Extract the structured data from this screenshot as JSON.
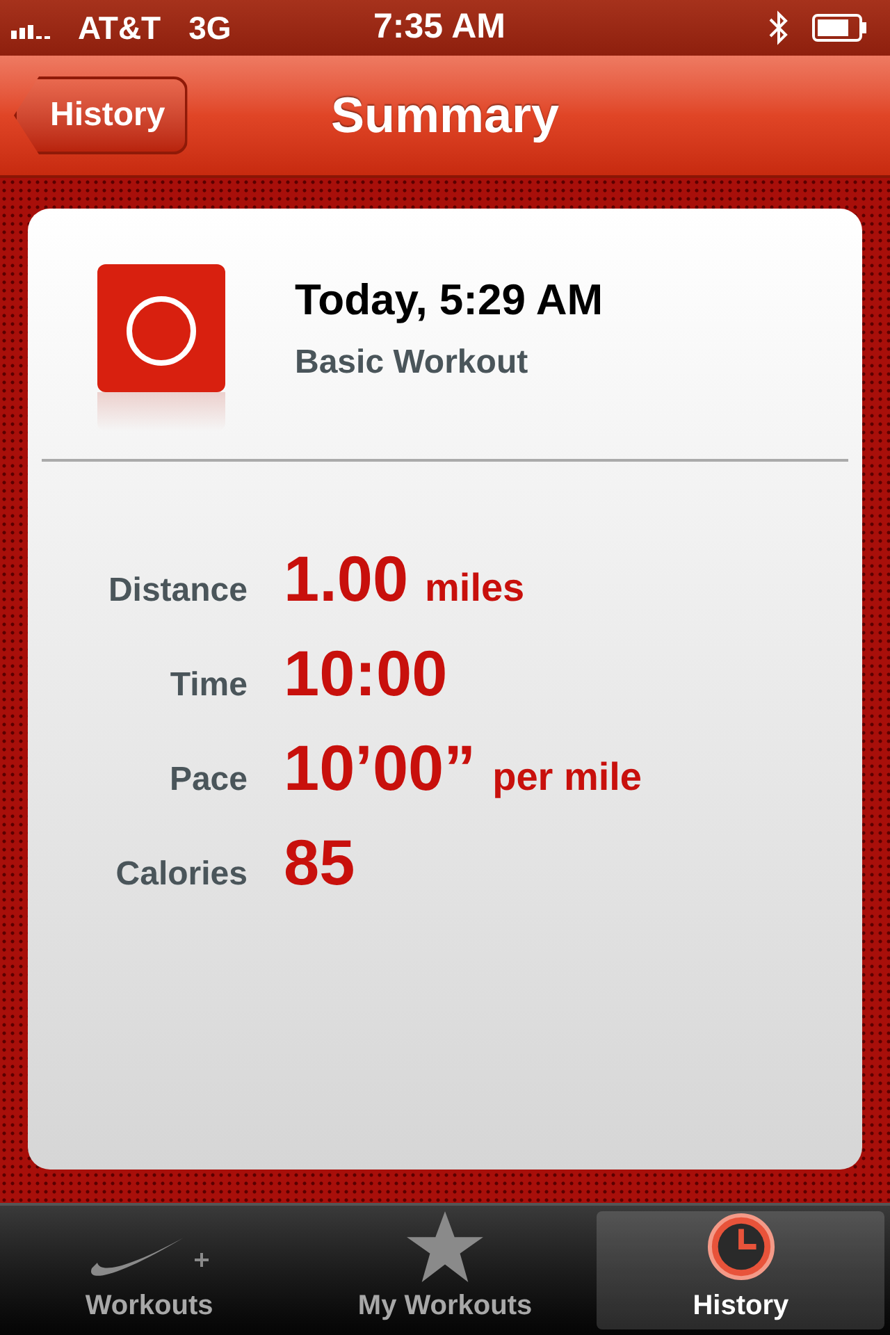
{
  "status_bar": {
    "carrier": "AT&T",
    "network": "3G",
    "time": "7:35 AM"
  },
  "nav_bar": {
    "back": "History",
    "title": "Summary"
  },
  "workout": {
    "title": "Today, 5:29 AM",
    "subtitle": "Basic Workout"
  },
  "stats": [
    {
      "label": "Distance",
      "value": "1.00",
      "unit": "miles"
    },
    {
      "label": "Time",
      "value": "10:00"
    },
    {
      "label": "Pace",
      "value": "10’00”",
      "unit": "per mile"
    },
    {
      "label": "Calories",
      "value": "85"
    }
  ],
  "tabs": [
    {
      "label": "Workouts",
      "selected": false
    },
    {
      "label": "My Workouts",
      "selected": false
    },
    {
      "label": "History",
      "selected": true
    }
  ]
}
